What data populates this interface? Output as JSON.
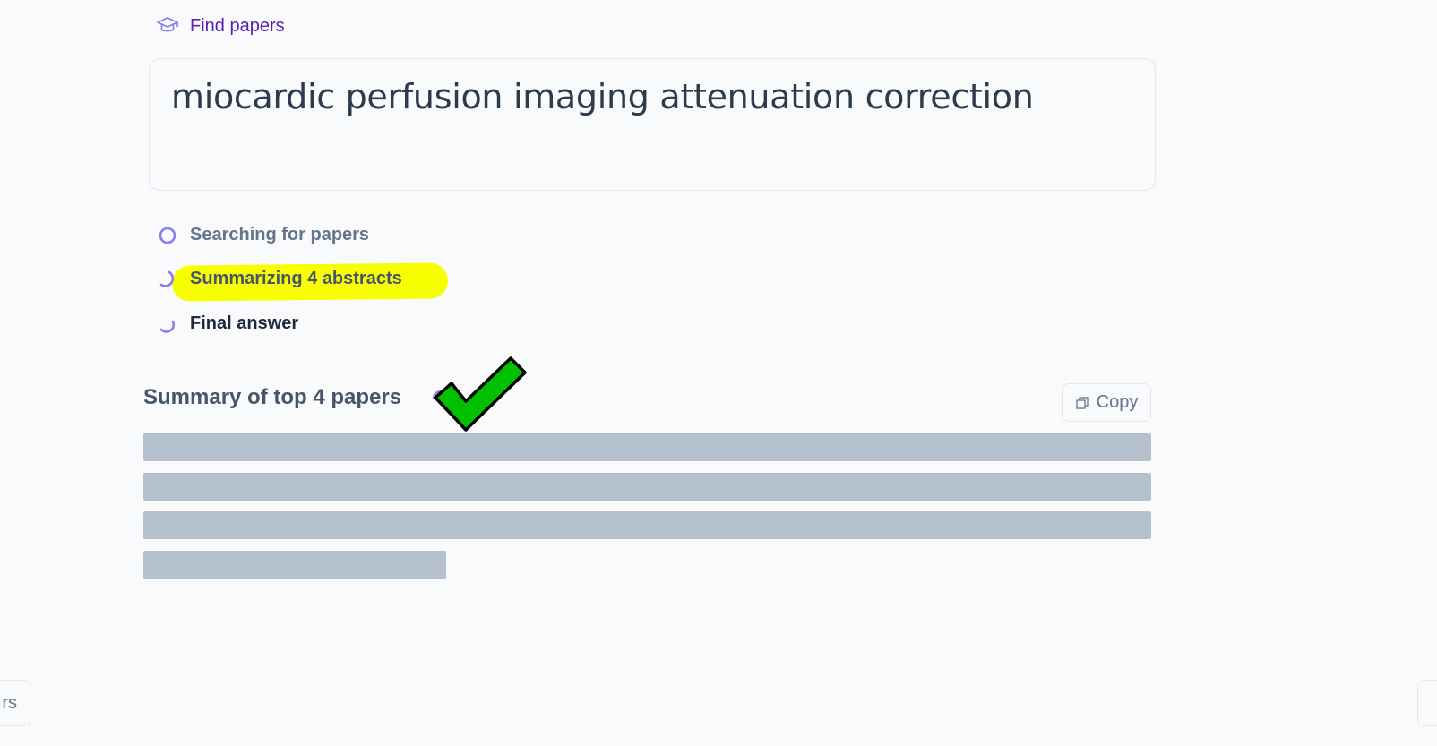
{
  "header": {
    "find_papers_label": "Find papers",
    "icon": "graduation-cap-icon"
  },
  "query": {
    "text": "miocardic perfusion imaging attenuation correction"
  },
  "steps": [
    {
      "label": "Searching for papers",
      "status": "pending",
      "icon": "circle-icon"
    },
    {
      "label": "Summarizing 4 abstracts",
      "status": "in-progress",
      "icon": "spinner-icon",
      "highlighted": true
    },
    {
      "label": "Final answer",
      "status": "in-progress",
      "icon": "spinner-icon"
    }
  ],
  "summary": {
    "title": "Summary of top 4 papers",
    "copy_label": "Copy",
    "copy_icon": "copy-icon",
    "loading": true,
    "skeleton_lines": 4
  },
  "overlay": {
    "icon": "checkmark-icon",
    "color": "#00c000"
  },
  "edge_buttons": {
    "left_label_fragment": "rs"
  },
  "colors": {
    "accent": "#5b21b6",
    "spinner": "#8b7cf0",
    "highlight": "#f8ff00",
    "skeleton": "#b6c1ce",
    "background": "#f8fafc"
  }
}
